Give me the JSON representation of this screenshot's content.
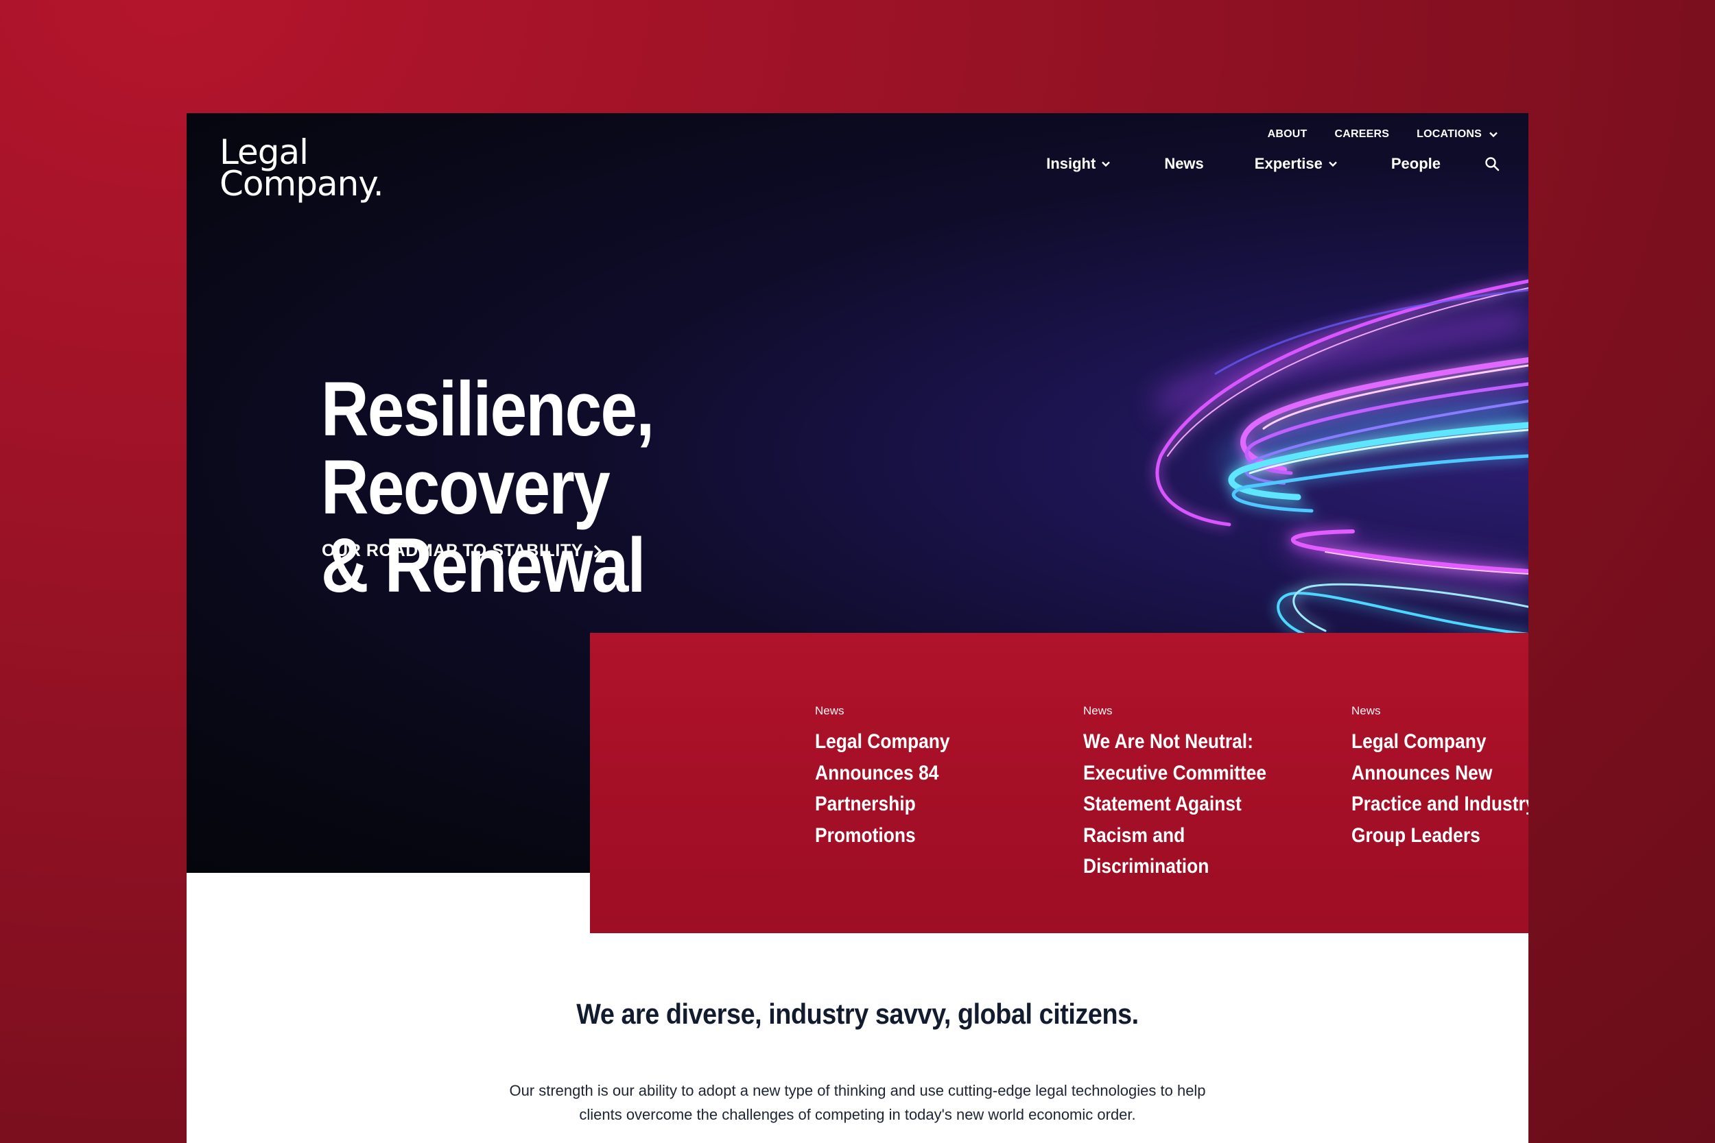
{
  "brand": {
    "logo_line1": "Legal",
    "logo_line2": "Company."
  },
  "utility_nav": [
    {
      "label": "ABOUT"
    },
    {
      "label": "CAREERS"
    },
    {
      "label": "LOCATIONS"
    }
  ],
  "main_nav": [
    {
      "label": "Insight"
    },
    {
      "label": "News"
    },
    {
      "label": "Expertise"
    },
    {
      "label": "People"
    }
  ],
  "hero": {
    "title_line1": "Resilience, Recovery",
    "title_line2": "& Renewal",
    "cta": "OUR ROADMAP TO STABILITY"
  },
  "news_cards": [
    {
      "tag": "News",
      "title_lines": [
        "Legal Company",
        "Announces 84",
        "Partnership",
        "Promotions"
      ]
    },
    {
      "tag": "News",
      "title_lines": [
        "We Are Not Neutral:",
        "Executive Committee",
        "Statement Against",
        "Racism and",
        "Discrimination"
      ]
    },
    {
      "tag": "News",
      "title_lines": [
        "Legal Company",
        "Announces New",
        "Practice and Industry",
        "Group Leaders"
      ]
    }
  ],
  "about": {
    "heading": "We are diverse, industry savvy, global citizens.",
    "body_line1": "Our strength is our ability to adopt a new type of thinking and use cutting-edge legal technologies to help",
    "body_line2": "clients overcome the challenges of competing in today's new world economic order."
  },
  "colors": {
    "page_background": "#9a1226",
    "hero_background": "#080815",
    "news_panel": "#a8112a",
    "accent_magenta": "#e24dff",
    "accent_cyan": "#5be7ff",
    "heading_text": "#131b2e"
  },
  "icons": {
    "search": "search-icon",
    "dropdown": "chevron-down-icon",
    "cta_arrow": "chevron-right-icon"
  }
}
